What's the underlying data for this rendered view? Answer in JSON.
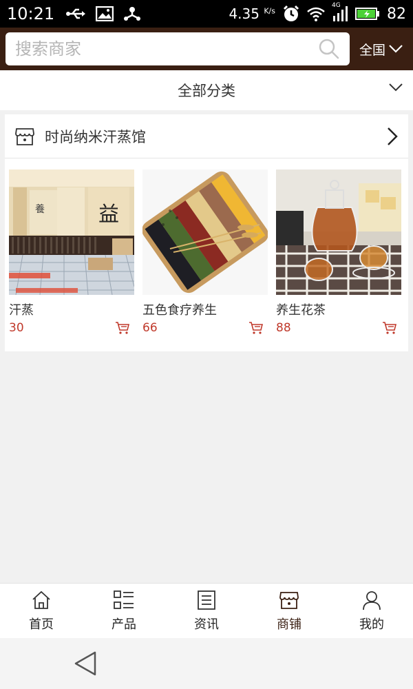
{
  "status_bar": {
    "time": "10:21",
    "speed_value": "4.35",
    "speed_unit": "K/s",
    "network": "4G",
    "battery": "82"
  },
  "search": {
    "placeholder": "搜索商家",
    "region_label": "全国"
  },
  "category": {
    "label": "全部分类"
  },
  "shop": {
    "name": "时尚纳米汗蒸馆",
    "products": [
      {
        "title": "汗蒸",
        "price": "30"
      },
      {
        "title": "五色食疗养生",
        "price": "66"
      },
      {
        "title": "养生花茶",
        "price": "88"
      }
    ]
  },
  "bottom_nav": {
    "items": [
      {
        "label": "首页",
        "icon": "home-icon"
      },
      {
        "label": "产品",
        "icon": "product-list-icon"
      },
      {
        "label": "资讯",
        "icon": "news-icon"
      },
      {
        "label": "商铺",
        "icon": "store-icon"
      },
      {
        "label": "我的",
        "icon": "user-icon"
      }
    ],
    "active_index": 3
  },
  "colors": {
    "header_bg": "#3a1f12",
    "price": "#c0392b",
    "page_bg": "#f1f1f1"
  }
}
